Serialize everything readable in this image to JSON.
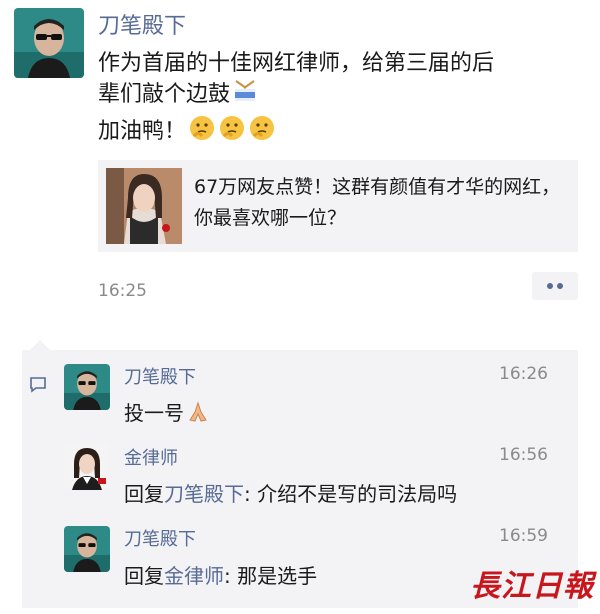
{
  "post": {
    "author": "刀笔殿下",
    "text_line1": "作为首届的十佳网红律师，给第三届的后",
    "text_line2": "辈们敲个边鼓",
    "text_line3": "加油鸭！",
    "link_title": "67万网友点赞！这群有颜值有才华的网红，你最喜欢哪一位？",
    "time": "16:25"
  },
  "comments": [
    {
      "author": "刀笔殿下",
      "time": "16:26",
      "text": "投一号"
    },
    {
      "author": "金律师",
      "time": "16:56",
      "reply_prefix": "回复",
      "reply_to": "刀笔殿下",
      "text": ": 介绍不是写的司法局吗"
    },
    {
      "author": "刀笔殿下",
      "time": "16:59",
      "reply_prefix": "回复",
      "reply_to": "金律师",
      "text": ": 那是选手"
    }
  ],
  "watermark": "長江日報",
  "colors": {
    "name_link": "#576b95",
    "watermark": "#c8161d",
    "card_bg": "#f3f3f5"
  },
  "icons": [
    "drum-icon",
    "thinking-face-emoji",
    "praying-hands-emoji",
    "comment-bubble-icon",
    "more-dots-icon"
  ]
}
